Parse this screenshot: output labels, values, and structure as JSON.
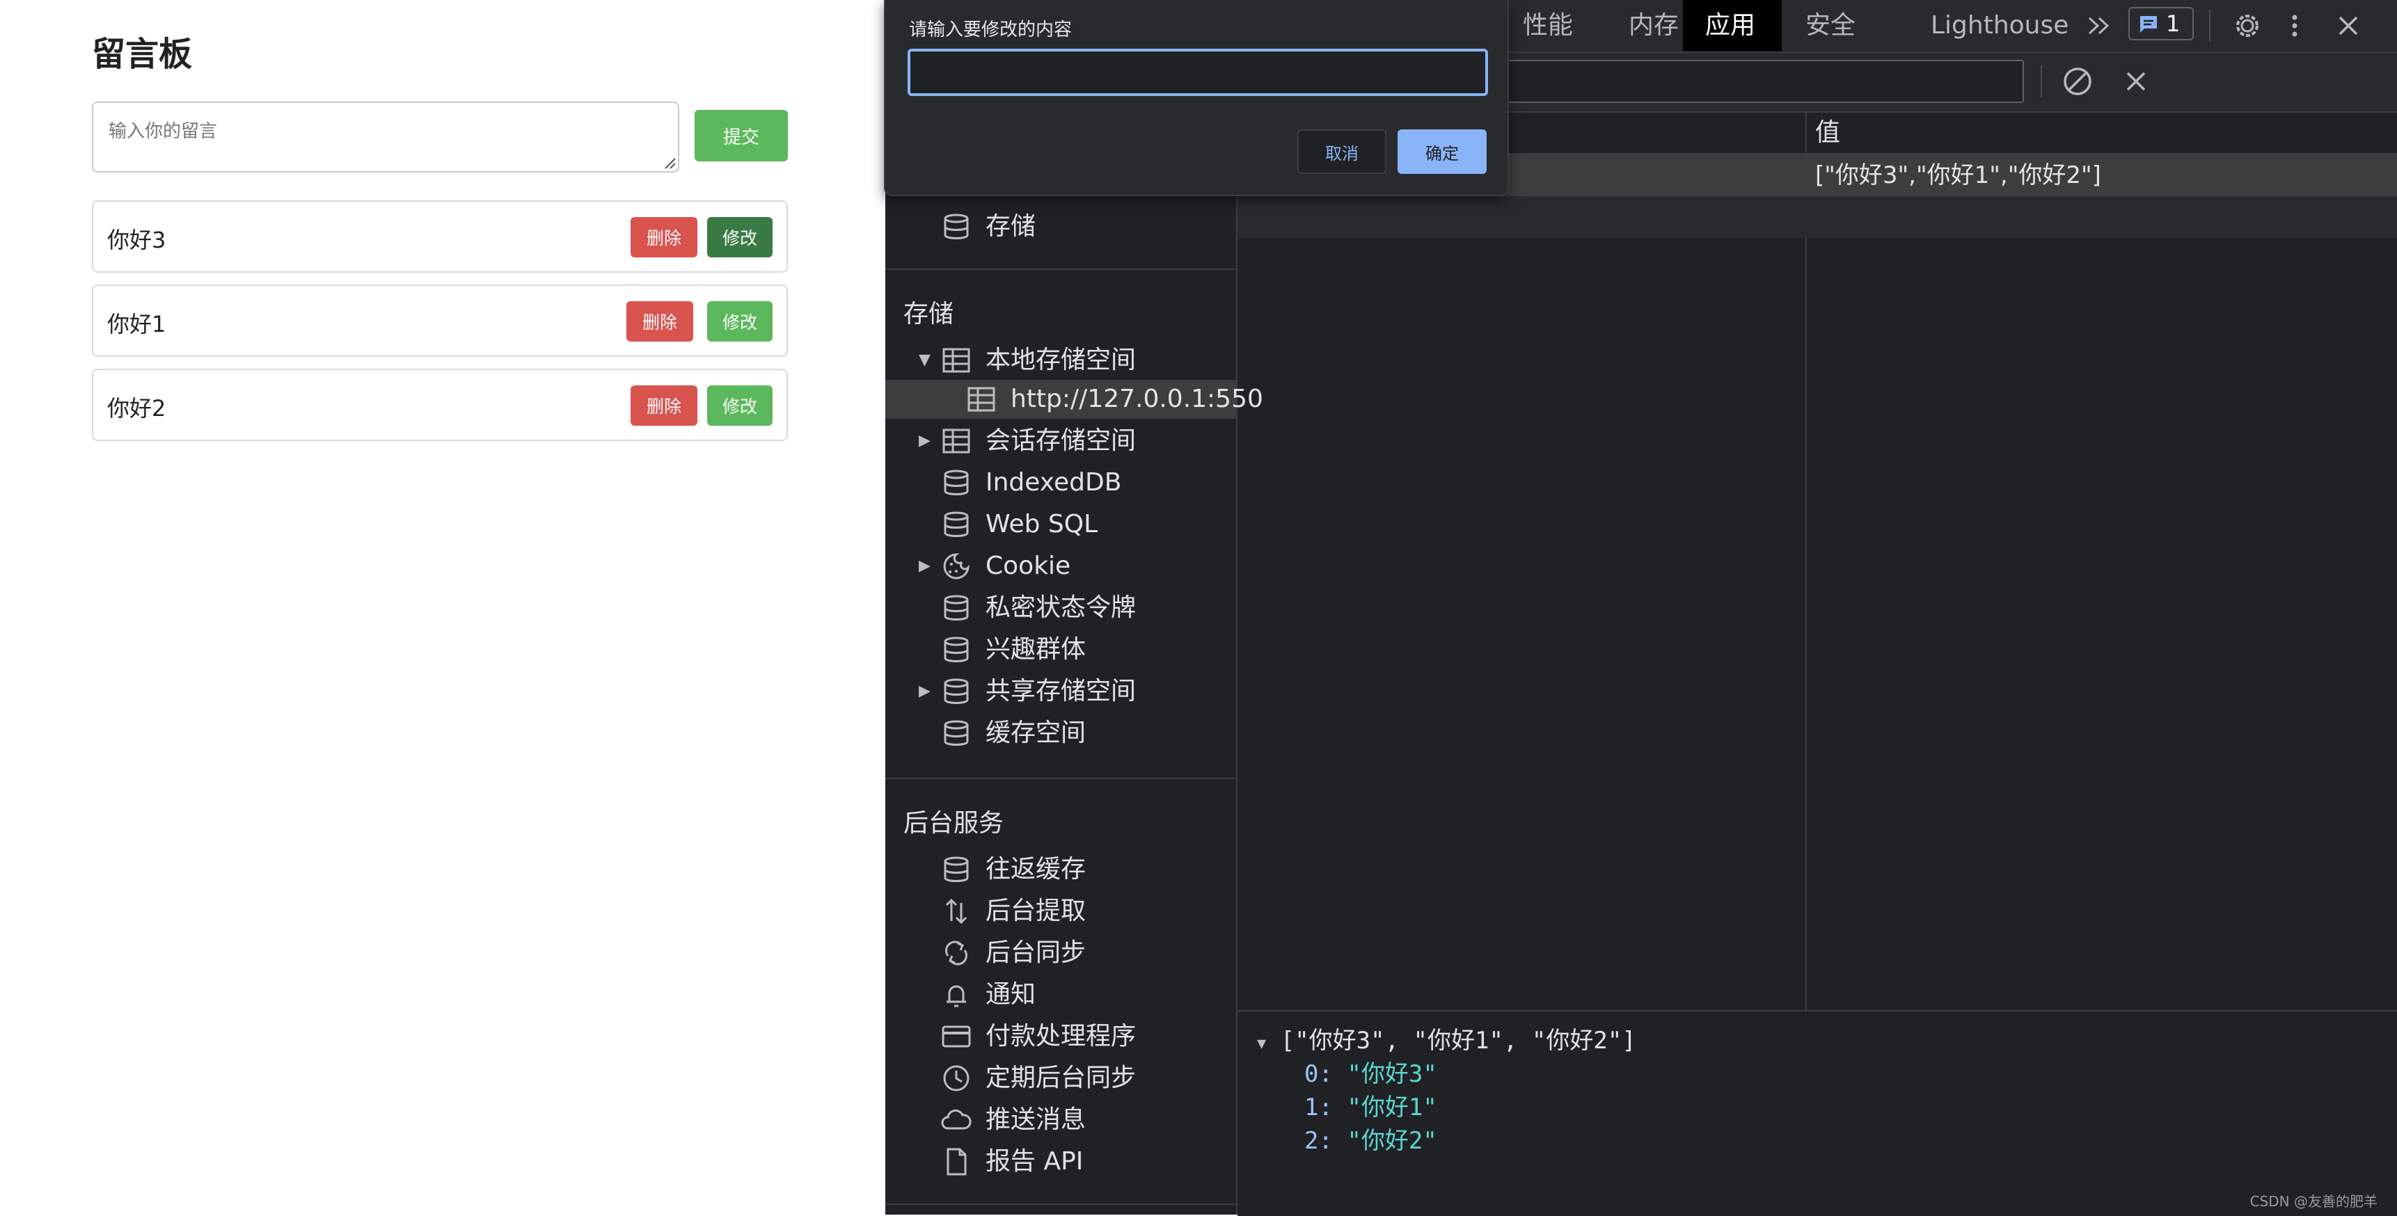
{
  "webpage": {
    "title": "留言板",
    "input_placeholder": "输入你的留言",
    "submit_label": "提交",
    "messages": [
      {
        "text": "你好3",
        "delete_label": "删除",
        "edit_label": "修改"
      },
      {
        "text": "你好1",
        "delete_label": "删除",
        "edit_label": "修改"
      },
      {
        "text": "你好2",
        "delete_label": "删除",
        "edit_label": "修改"
      }
    ]
  },
  "devtools": {
    "tabs": [
      "性能",
      "内存",
      "应用",
      "安全",
      "Lighthouse"
    ],
    "active_tab": "应用",
    "message_count": "1",
    "sidebar": {
      "partial_item": "存储",
      "storage_section": "存储",
      "storage_items": [
        "本地存储空间",
        "http://127.0.0.1:550",
        "会话存储空间",
        "IndexedDB",
        "Web SQL",
        "Cookie",
        "私密状态令牌",
        "兴趣群体",
        "共享存储空间",
        "缓存空间"
      ],
      "background_section": "后台服务",
      "background_items": [
        "往返缓存",
        "后台提取",
        "后台同步",
        "通知",
        "付款处理程序",
        "定期后台同步",
        "推送消息",
        "报告 API"
      ]
    },
    "table": {
      "value_header": "值",
      "rows": [
        {
          "key": "",
          "value": "[\"你好3\",\"你好1\",\"你好2\"]"
        }
      ]
    },
    "preview": {
      "summary": "[\"你好3\", \"你好1\", \"你好2\"]",
      "items": [
        {
          "index": "0",
          "value": "\"你好3\""
        },
        {
          "index": "1",
          "value": "\"你好1\""
        },
        {
          "index": "2",
          "value": "\"你好2\""
        }
      ]
    }
  },
  "dialog": {
    "title": "请输入要修改的内容",
    "value": "",
    "cancel_label": "取消",
    "ok_label": "确定"
  },
  "watermark": "CSDN @友善的肥羊",
  "colors": {
    "primary_green": "#5cb85c",
    "danger_red": "#d9534f",
    "devtools_bg": "#202124",
    "dialog_accent": "#8ab4f8"
  }
}
